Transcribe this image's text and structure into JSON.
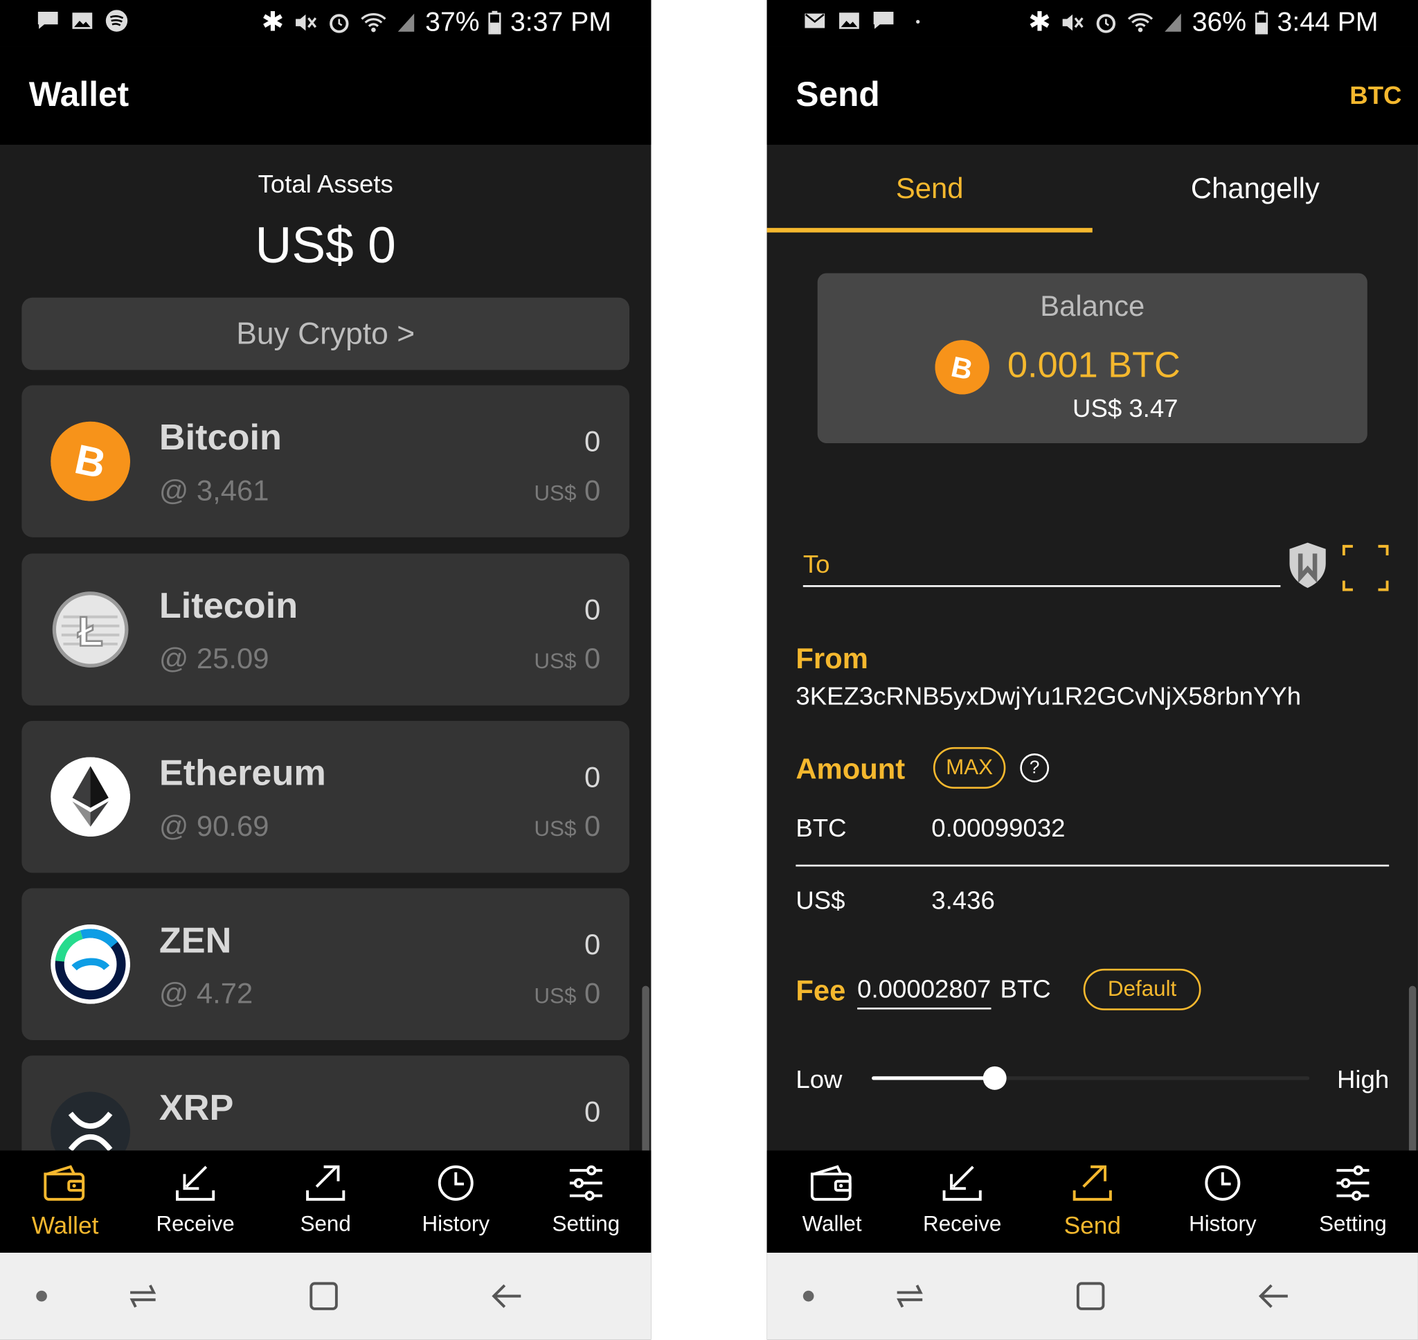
{
  "left": {
    "status": {
      "battery": "37%",
      "time": "3:37 PM"
    },
    "title": "Wallet",
    "total_assets_label": "Total Assets",
    "total_assets_value": "US$ 0",
    "buy_label": "Buy Crypto >",
    "coins": [
      {
        "name": "Bitcoin",
        "rate": "@ 3,461",
        "balance": "0",
        "usd_prefix": "US$",
        "usd": "0",
        "color": "#f7931a"
      },
      {
        "name": "Litecoin",
        "rate": "@ 25.09",
        "balance": "0",
        "usd_prefix": "US$",
        "usd": "0",
        "color": "#bebebe"
      },
      {
        "name": "Ethereum",
        "rate": "@ 90.69",
        "balance": "0",
        "usd_prefix": "US$",
        "usd": "0",
        "color": "#ffffff"
      },
      {
        "name": "ZEN",
        "rate": "@ 4.72",
        "balance": "0",
        "usd_prefix": "US$",
        "usd": "0",
        "color": "#ffffff"
      },
      {
        "name": "XRP",
        "rate": "",
        "balance": "0",
        "usd_prefix": "",
        "usd": "",
        "color": "#23292f"
      }
    ],
    "nav": [
      {
        "label": "Wallet",
        "icon": "wallet-icon",
        "active": true
      },
      {
        "label": "Receive",
        "icon": "receive-icon",
        "active": false
      },
      {
        "label": "Send",
        "icon": "send-icon",
        "active": false
      },
      {
        "label": "History",
        "icon": "history-icon",
        "active": false
      },
      {
        "label": "Setting",
        "icon": "setting-icon",
        "active": false
      }
    ]
  },
  "right": {
    "status": {
      "battery": "36%",
      "time": "3:44 PM"
    },
    "title": "Send",
    "currency": "BTC",
    "tabs": [
      {
        "label": "Send",
        "active": true
      },
      {
        "label": "Changelly",
        "active": false
      }
    ],
    "balance": {
      "label": "Balance",
      "amount": "0.001 BTC",
      "usd": "US$ 3.47"
    },
    "to_label": "To",
    "from_label": "From",
    "from_address": "3KEZ3cRNB5yxDwjYu1R2GCvNjX58rbnYYh",
    "amount_label": "Amount",
    "max_label": "MAX",
    "help_symbol": "?",
    "btc_currency": "BTC",
    "btc_value": "0.00099032",
    "usd_currency": "US$",
    "usd_value": "3.436",
    "fee_label": "Fee",
    "fee_value": "0.00002807",
    "fee_unit": "BTC",
    "default_label": "Default",
    "low_label": "Low",
    "high_label": "High",
    "fee_level": 0.28,
    "nav": [
      {
        "label": "Wallet",
        "icon": "wallet-icon",
        "active": false
      },
      {
        "label": "Receive",
        "icon": "receive-icon",
        "active": false
      },
      {
        "label": "Send",
        "icon": "send-icon",
        "active": true
      },
      {
        "label": "History",
        "icon": "history-icon",
        "active": false
      },
      {
        "label": "Setting",
        "icon": "setting-icon",
        "active": false
      }
    ]
  },
  "colors": {
    "accent": "#f5b82e",
    "background": "#1c1c1c",
    "card": "#343434",
    "bar": "#000000"
  }
}
